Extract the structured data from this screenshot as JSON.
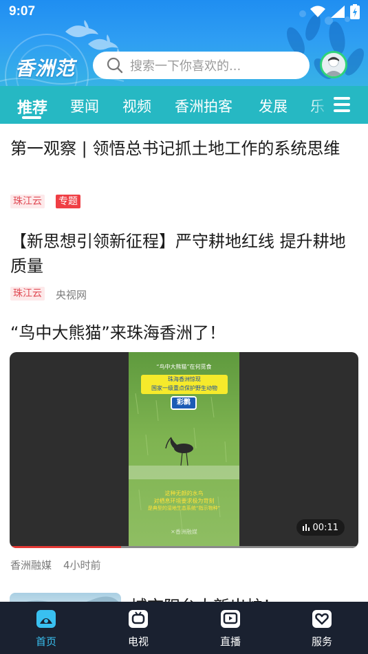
{
  "status_bar": {
    "time": "9:07"
  },
  "header": {
    "logo_text": "香洲范",
    "search_placeholder": "搜索一下你喜欢的...",
    "accent_color": "#26b8c3"
  },
  "tabs": [
    {
      "label": "推荐",
      "active": true
    },
    {
      "label": "要闻"
    },
    {
      "label": "视频"
    },
    {
      "label": "香洲拍客"
    },
    {
      "label": "发展"
    },
    {
      "label": "乐"
    }
  ],
  "feed": [
    {
      "title": "第一观察 | 领悟总书记抓土地工作的系统思维",
      "tags": [
        "珠江云",
        "专题"
      ]
    },
    {
      "title": "【新思想引领新征程】严守耕地红线 提升耕地质量",
      "tags": [
        "珠江云"
      ],
      "source": "央视网"
    },
    {
      "title": "“鸟中大熊猫”来珠海香洲了！",
      "video": {
        "duration": "00:11",
        "progress": 0.32,
        "overlay_heading": "“鸟中大熊猫”在何觅食",
        "overlay_banner_line1": "珠海香洲惊现",
        "overlay_banner_line2": "国家一级重点保护野生动物",
        "overlay_species": "彩鹮",
        "overlay_caption_line1": "这种无颜的水鸟",
        "overlay_caption_line2": "对栖息环境要求极为苛刻",
        "overlay_caption_line3": "是典型的湿地生态系统“指示物种”",
        "overlay_watermark": "✕香洲融媒"
      },
      "source": "香洲融媒",
      "time": "4小时前"
    },
    {
      "title": "城市阳台大新出炉！"
    }
  ],
  "bottom_nav": [
    {
      "label": "首页",
      "icon": "home-icon",
      "active": true
    },
    {
      "label": "电视",
      "icon": "tv-icon"
    },
    {
      "label": "直播",
      "icon": "live-play-icon"
    },
    {
      "label": "服务",
      "icon": "service-heart-icon"
    }
  ]
}
